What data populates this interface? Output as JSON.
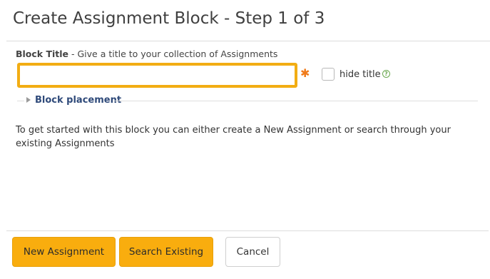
{
  "dialog": {
    "title": "Create Assignment Block - Step 1 of 3"
  },
  "block_title_field": {
    "label": "Block Title",
    "hint": " - Give a title to your collection of Assignments",
    "value": "",
    "required_marker": "✱",
    "accent_color": "#f2ad13"
  },
  "hide_title": {
    "label": "hide title",
    "checked": false,
    "help_glyph": "?"
  },
  "block_placement": {
    "label": "Block placement",
    "expanded": false
  },
  "intro": {
    "text": "To get started with this block you can either create a New Assignment or search through your existing Assignments"
  },
  "footer": {
    "new_assignment_label": "New Assignment",
    "search_existing_label": "Search Existing",
    "cancel_label": "Cancel",
    "primary_color": "#f9ad0e"
  }
}
